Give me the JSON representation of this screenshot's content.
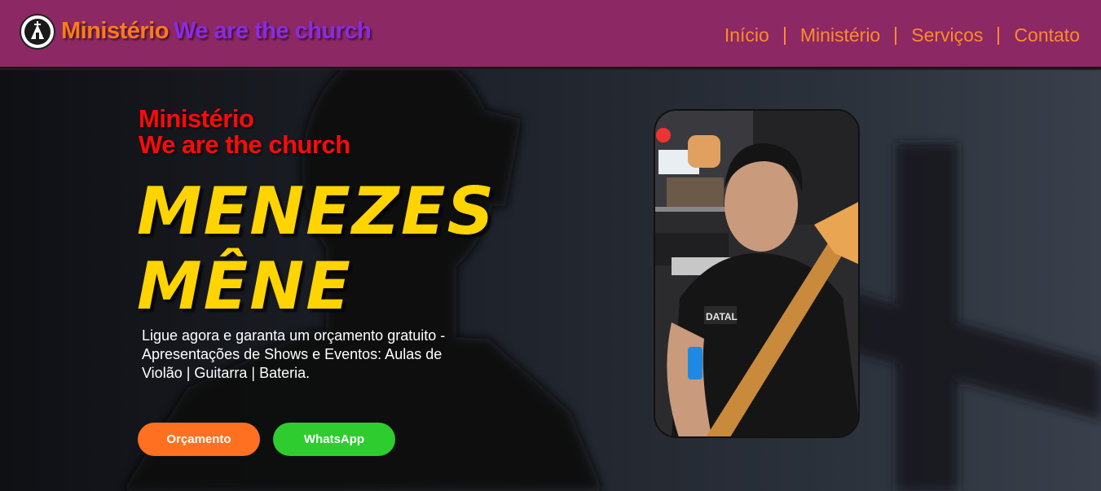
{
  "header": {
    "brand_part1": "Ministério",
    "brand_part2": "We are the church",
    "nav": [
      "Início",
      "Ministério",
      "Serviços",
      "Contato"
    ]
  },
  "hero": {
    "subtitle_line1": "Ministério",
    "subtitle_line2": "We are the church",
    "name_line1": "MENEZES",
    "name_line2": "MÊNE",
    "description": "Ligue agora e garanta um orçamento gratuito - Apresentações de Shows e Eventos: Aulas de Violão | Guitarra | Bateria.",
    "btn_quote": "Orçamento",
    "btn_whatsapp": "WhatsApp"
  },
  "colors": {
    "header_bg": "#8c2863",
    "accent_orange": "#ff7a1a",
    "accent_purple": "#8a2be2",
    "subtitle_red": "#ff0a0a",
    "name_yellow": "#ffd400",
    "whatsapp_green": "#2ecc2e"
  },
  "icons": [
    "church-logo-icon"
  ]
}
